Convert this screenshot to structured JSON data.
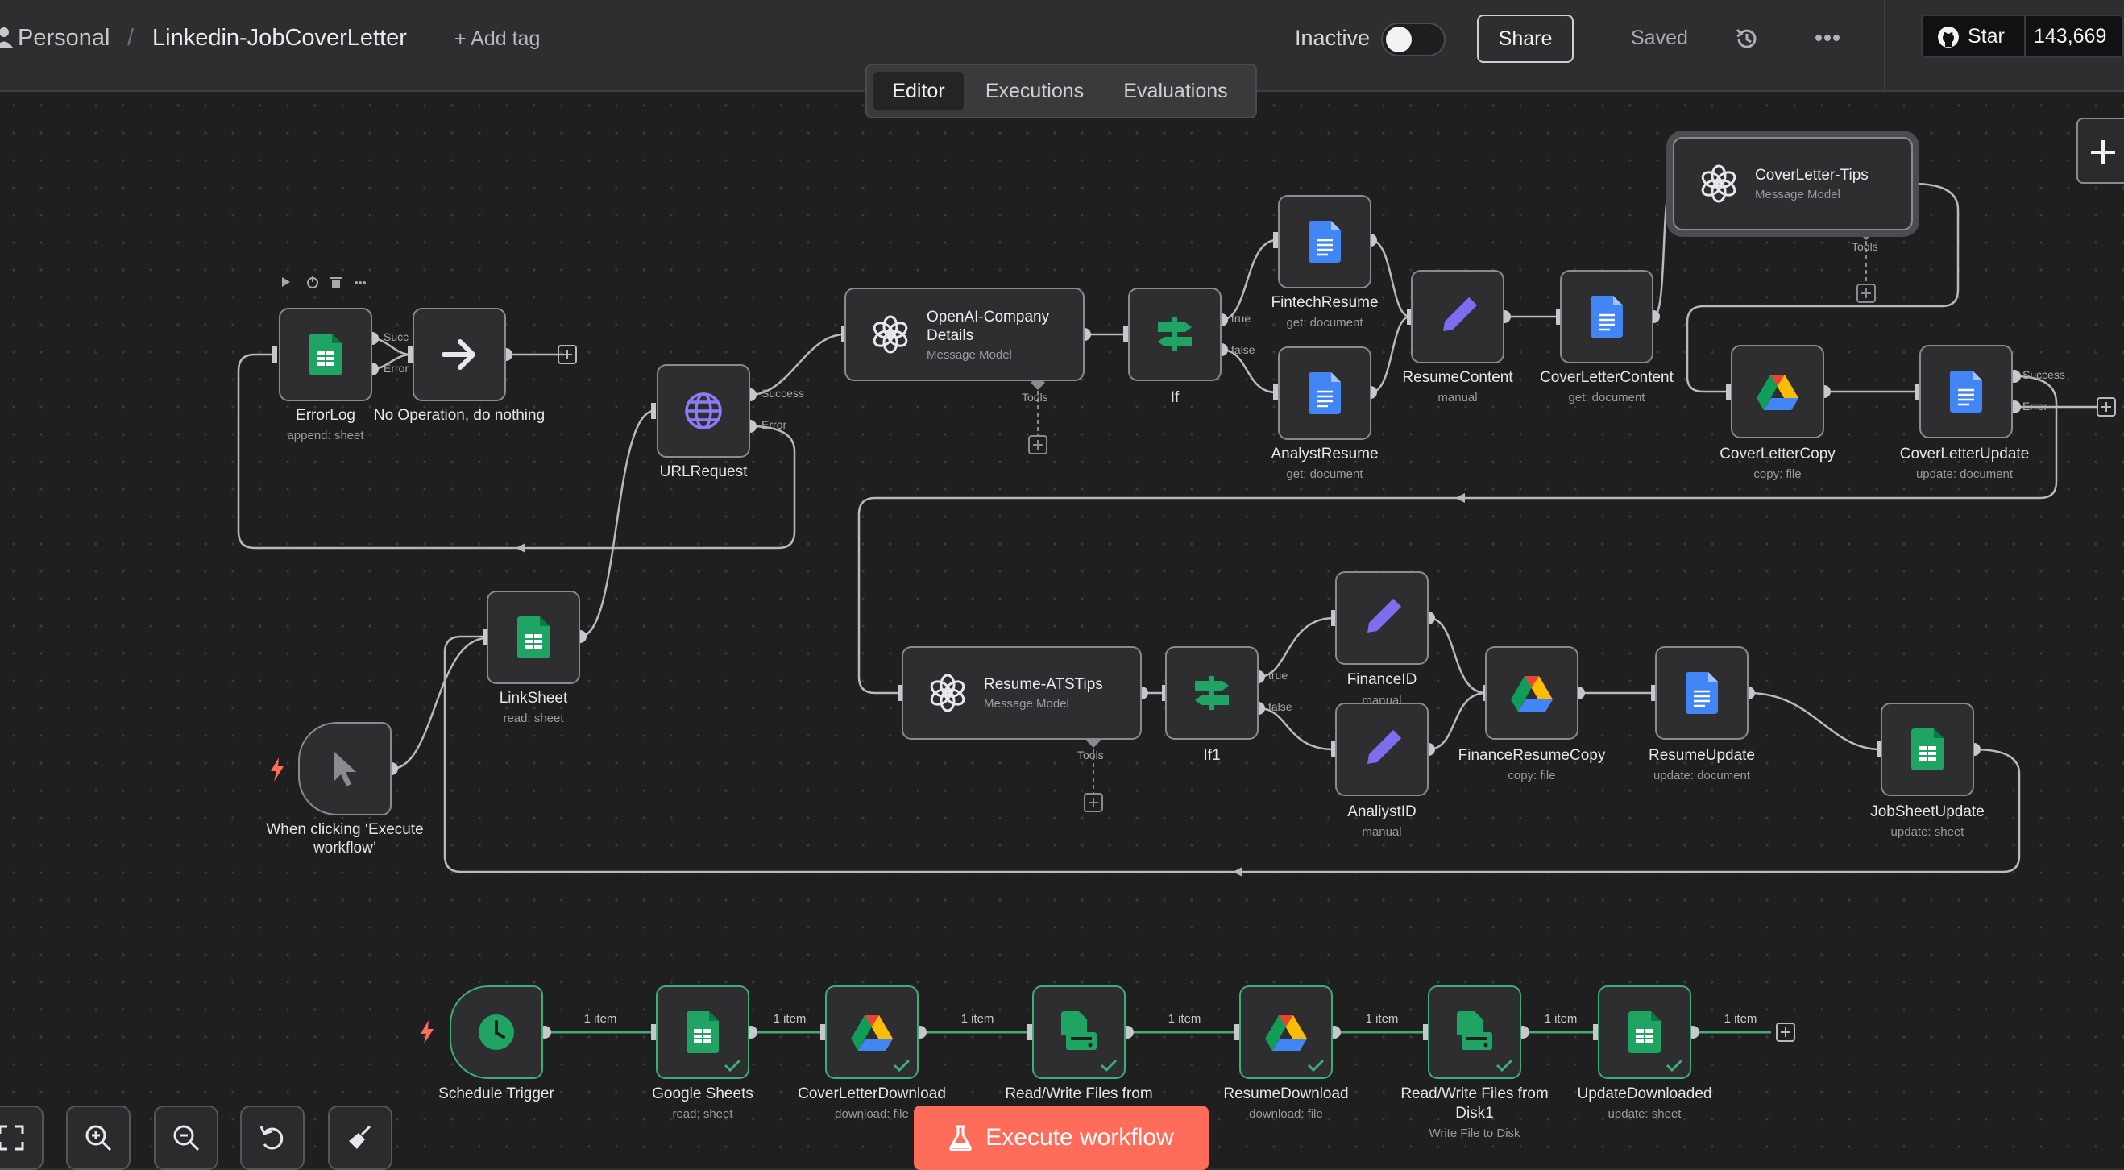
{
  "header": {
    "project": "Personal",
    "separator": "/",
    "workflow_name": "Linkedin-JobCoverLetter",
    "add_tag": "+ Add tag",
    "status_label": "Inactive",
    "share_label": "Share",
    "saved_label": "Saved",
    "github_star_label": "Star",
    "github_star_count": "143,669"
  },
  "tabs": [
    {
      "label": "Editor",
      "active": true
    },
    {
      "label": "Executions",
      "active": false
    },
    {
      "label": "Evaluations",
      "active": false
    }
  ],
  "nodes": {
    "errorlog": {
      "name": "ErrorLog",
      "sub": "append: sheet",
      "ports": [
        "Succ",
        "Error"
      ]
    },
    "noop": {
      "name": "No Operation, do nothing"
    },
    "urlrequest": {
      "name": "URLRequest",
      "ports": [
        "Success",
        "Error"
      ]
    },
    "linksheet": {
      "name": "LinkSheet",
      "sub": "read: sheet"
    },
    "manual_trigger": {
      "name_line1": "When clicking ‘Execute",
      "name_line2": "workflow’"
    },
    "openai_company": {
      "name_line1": "OpenAI-Company",
      "name_line2": "Details",
      "sub": "Message Model",
      "tools": "Tools"
    },
    "if": {
      "name": "If",
      "ports": [
        "true",
        "false"
      ]
    },
    "fintech_resume": {
      "name": "FintechResume",
      "sub": "get: document"
    },
    "analyst_resume": {
      "name": "AnalystResume",
      "sub": "get: document"
    },
    "resume_content": {
      "name": "ResumeContent",
      "sub": "manual"
    },
    "coverletter_content": {
      "name": "CoverLetterContent",
      "sub": "get: document"
    },
    "coverletter_tips": {
      "name": "CoverLetter-Tips",
      "sub": "Message Model",
      "tools": "Tools"
    },
    "coverletter_copy": {
      "name": "CoverLetterCopy",
      "sub": "copy: file"
    },
    "coverletter_update": {
      "name": "CoverLetterUpdate",
      "sub": "update: document",
      "ports": [
        "Success",
        "Error"
      ]
    },
    "resume_atstips": {
      "name": "Resume-ATSTips",
      "sub": "Message Model",
      "tools": "Tools"
    },
    "if1": {
      "name": "If1",
      "ports": [
        "true",
        "false"
      ]
    },
    "financeid": {
      "name": "FinanceID",
      "sub": "manual"
    },
    "analiystid": {
      "name": "AnaliystID",
      "sub": "manual"
    },
    "finance_resume_copy": {
      "name": "FinanceResumeCopy",
      "sub": "copy: file"
    },
    "resume_update": {
      "name": "ResumeUpdate",
      "sub": "update: document"
    },
    "jobsheet_update": {
      "name": "JobSheetUpdate",
      "sub": "update: sheet"
    },
    "schedule_trigger": {
      "name": "Schedule Trigger"
    },
    "google_sheets": {
      "name": "Google Sheets",
      "sub": "read: sheet"
    },
    "coverletter_download": {
      "name": "CoverLetterDownload",
      "sub": "download: file"
    },
    "readwrite_files": {
      "name": "Read/Write Files from"
    },
    "resume_download": {
      "name": "ResumeDownload",
      "sub": "download: file"
    },
    "readwrite_files1": {
      "name_line1": "Read/Write Files from",
      "name_line2": "Disk1",
      "sub": "Write File to Disk"
    },
    "update_downloaded": {
      "name": "UpdateDownloaded",
      "sub": "update: sheet"
    }
  },
  "item_count_label": "1 item",
  "execute_button": "Execute workflow",
  "colors": {
    "accent_orange": "#ff6d5a",
    "success_green": "#3fae74",
    "sheets_green": "#1fa463",
    "docs_blue": "#4285f4",
    "edit_purple": "#7b6ff0"
  }
}
